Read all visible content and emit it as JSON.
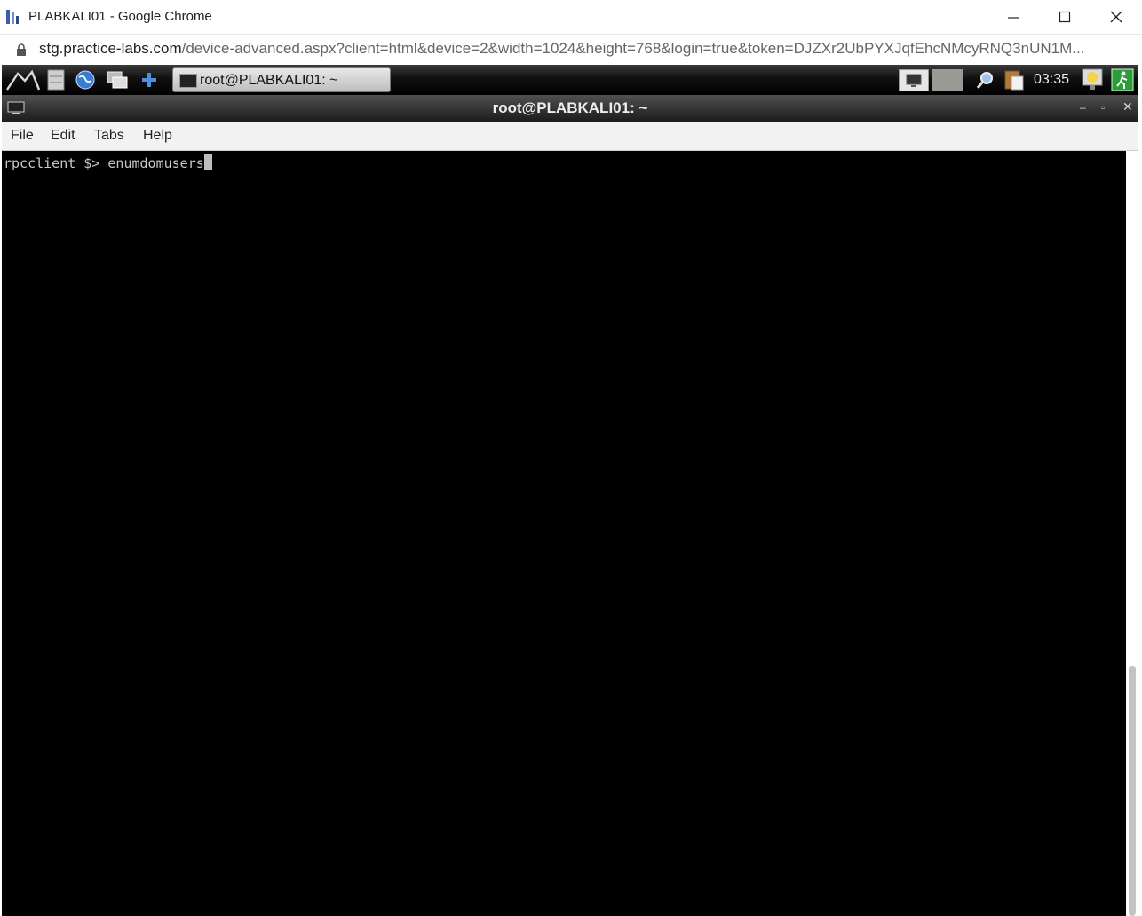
{
  "browser": {
    "title": "PLABKALI01 - Google Chrome",
    "url_host": "stg.practice-labs.com",
    "url_rest": "/device-advanced.aspx?client=html&device=2&width=1024&height=768&login=true&token=DJZXr2UbPYXJqfEhcNMcyRNQ3nUN1M...",
    "minimize_icon": "minimize-icon",
    "maximize_icon": "maximize-icon",
    "close_icon": "close-icon"
  },
  "panel": {
    "taskbar_window_label": "root@PLABKALI01: ~",
    "clock": "03:35"
  },
  "terminal": {
    "title": "root@PLABKALI01: ~",
    "menu": [
      "File",
      "Edit",
      "Tabs",
      "Help"
    ],
    "prompt": "rpcclient $> ",
    "command": "enumdomusers"
  }
}
